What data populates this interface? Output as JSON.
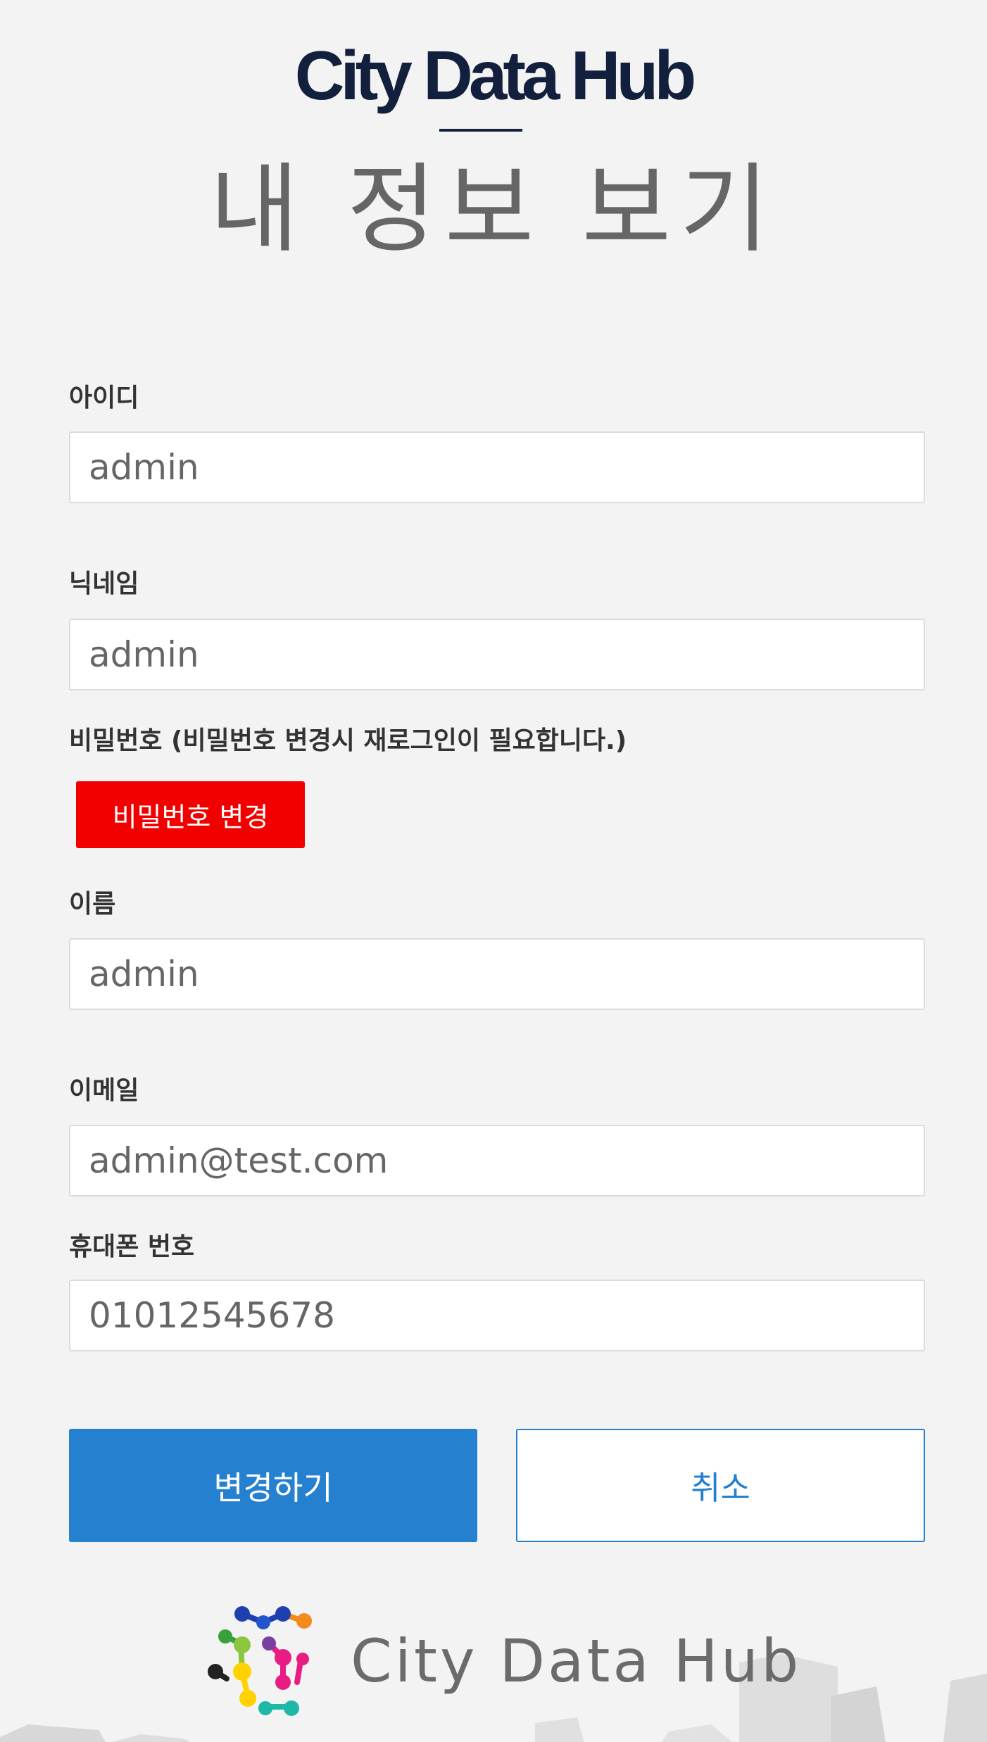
{
  "header": {
    "brand": "City Data Hub",
    "page_title": "내 정보 보기"
  },
  "form": {
    "id": {
      "label": "아이디",
      "value": "admin"
    },
    "nickname": {
      "label": "닉네임",
      "value": "admin"
    },
    "password": {
      "label": "비밀번호 (비밀번호 변경시 재로그인이 필요합니다.)",
      "button_label": "비밀번호 변경"
    },
    "name": {
      "label": "이름",
      "value": "admin"
    },
    "email": {
      "label": "이메일",
      "value": "admin@test.com"
    },
    "phone": {
      "label": "휴대폰 번호",
      "value": "01012545678"
    }
  },
  "actions": {
    "submit_label": "변경하기",
    "cancel_label": "취소"
  },
  "footer": {
    "brand": "City Data Hub",
    "logo_icon": "molecule-logo-icon"
  },
  "colors": {
    "brand_navy": "#13203d",
    "accent_blue": "#2580cf",
    "danger_red": "#f20000",
    "background": "#f3f3f3"
  }
}
